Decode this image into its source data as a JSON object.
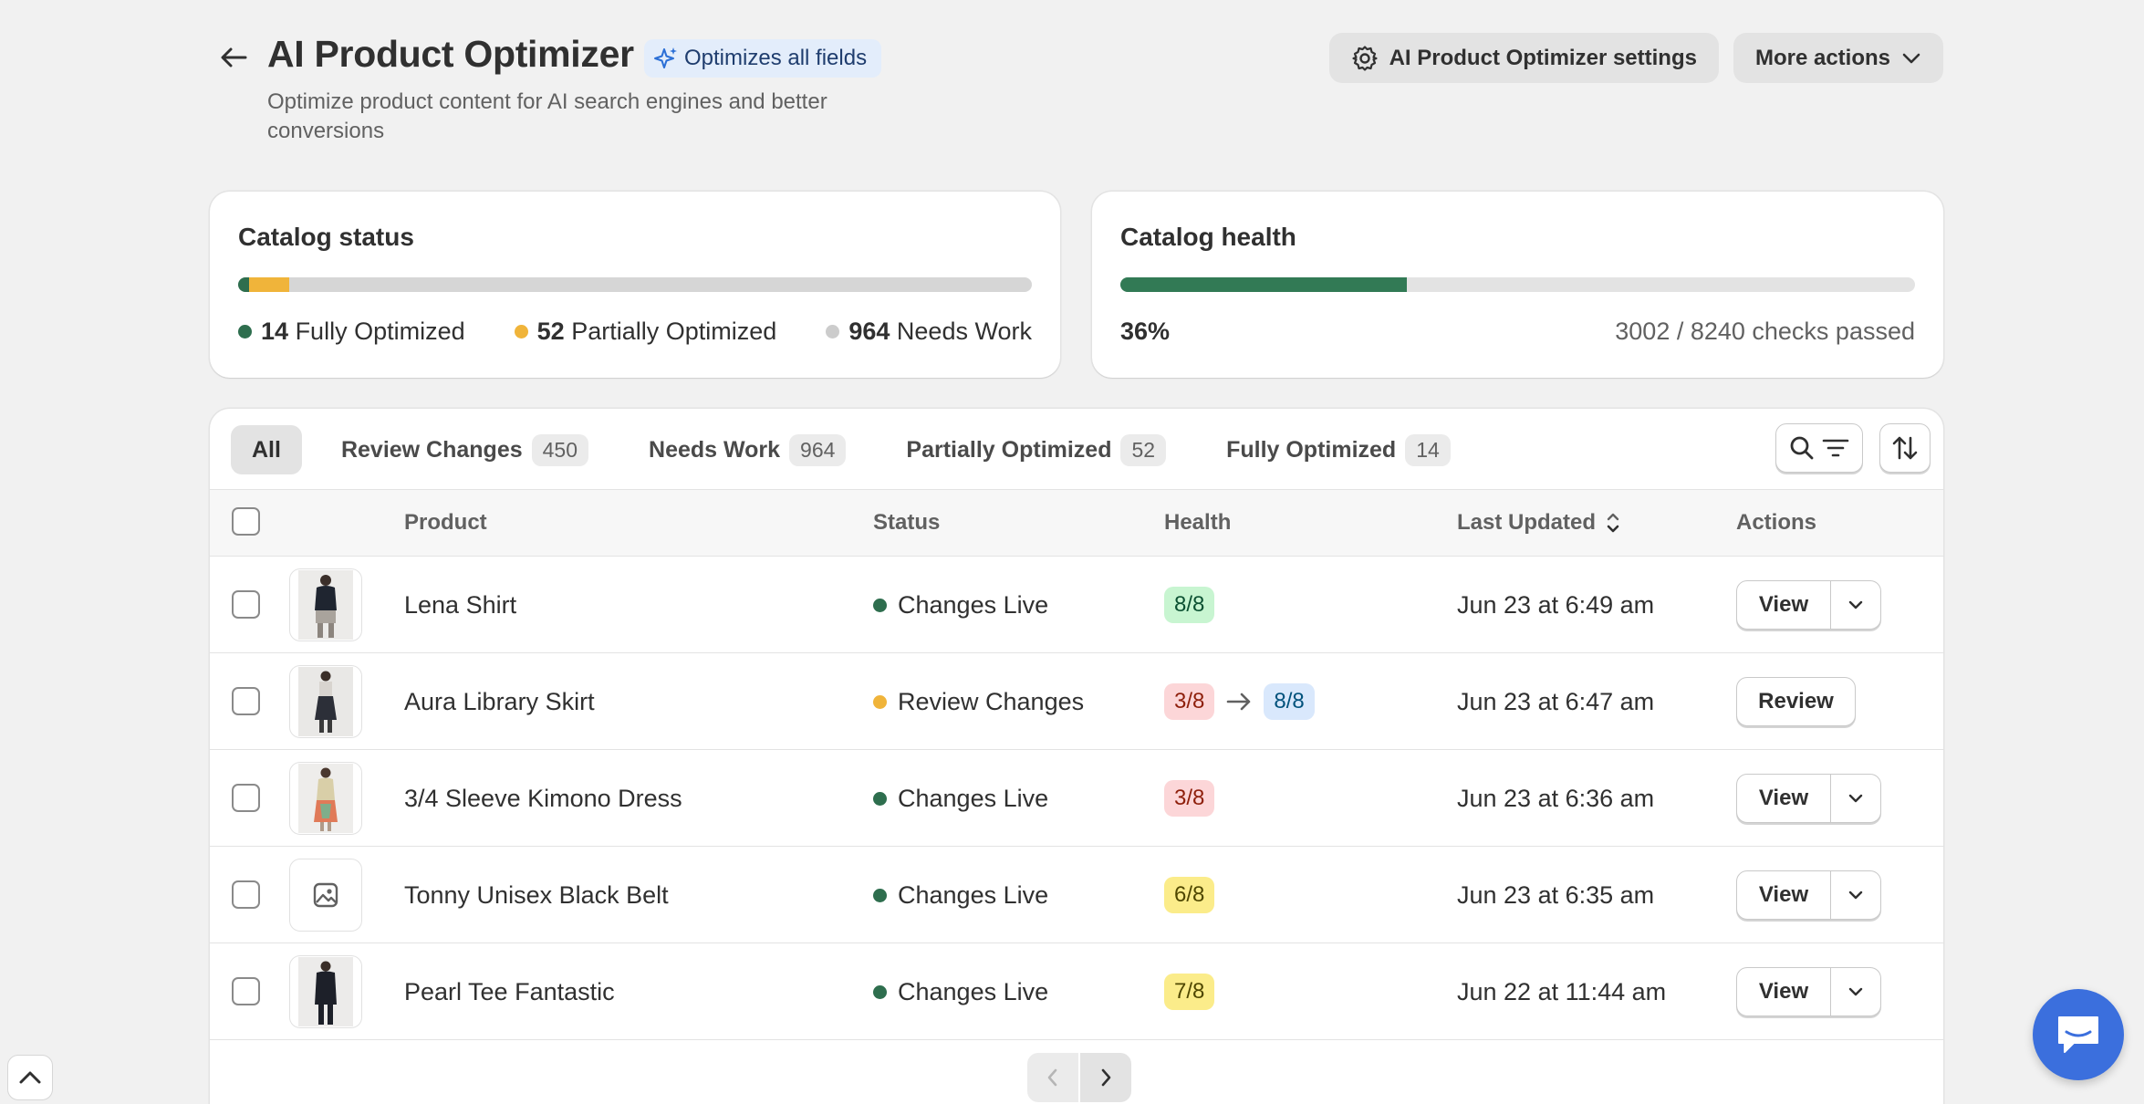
{
  "header": {
    "title": "AI Product Optimizer",
    "badge": "Optimizes all fields",
    "subtitle": "Optimize product content for AI search engines and better conversions",
    "settings_button": "AI Product Optimizer settings",
    "more_actions_button": "More actions"
  },
  "catalog_status": {
    "title": "Catalog status",
    "fully_count": "14",
    "fully_label": "Fully Optimized",
    "partial_count": "52",
    "partial_label": "Partially Optimized",
    "needs_count": "964",
    "needs_label": "Needs Work",
    "bar_fractions": {
      "fully": 0.0137,
      "partial": 0.051,
      "needs": 0.9353
    }
  },
  "catalog_health": {
    "title": "Catalog health",
    "percent": "36%",
    "checks": "3002 / 8240 checks passed",
    "fraction": 0.36
  },
  "colors": {
    "fully": "#2e6e4e",
    "partial": "#f0b43a",
    "needs": "#cccccc",
    "health_fill": "#327a55",
    "pill_green_bg": "#c8f5d1",
    "pill_red_bg": "#fcd6d8",
    "pill_yellow_bg": "#fbec8a",
    "pill_blue_bg": "#d9e8fc"
  },
  "tabs": [
    {
      "label": "All",
      "count": ""
    },
    {
      "label": "Review Changes",
      "count": "450"
    },
    {
      "label": "Needs Work",
      "count": "964"
    },
    {
      "label": "Partially Optimized",
      "count": "52"
    },
    {
      "label": "Fully Optimized",
      "count": "14"
    }
  ],
  "columns": {
    "product": "Product",
    "status": "Status",
    "health": "Health",
    "last_updated": "Last Updated",
    "actions": "Actions"
  },
  "rows": [
    {
      "name": "Lena Shirt",
      "status": "Changes Live",
      "health_from": "8/8",
      "health_to": "",
      "updated": "Jun 23 at 6:49 am",
      "action": "View"
    },
    {
      "name": "Aura Library Skirt",
      "status": "Review Changes",
      "health_from": "3/8",
      "health_to": "8/8",
      "updated": "Jun 23 at 6:47 am",
      "action": "Review"
    },
    {
      "name": "3/4 Sleeve Kimono Dress",
      "status": "Changes Live",
      "health_from": "3/8",
      "health_to": "",
      "updated": "Jun 23 at 6:36 am",
      "action": "View"
    },
    {
      "name": "Tonny Unisex Black Belt",
      "status": "Changes Live",
      "health_from": "6/8",
      "health_to": "",
      "updated": "Jun 23 at 6:35 am",
      "action": "View"
    },
    {
      "name": "Pearl Tee Fantastic",
      "status": "Changes Live",
      "health_from": "7/8",
      "health_to": "",
      "updated": "Jun 22 at 11:44 am",
      "action": "View"
    }
  ]
}
